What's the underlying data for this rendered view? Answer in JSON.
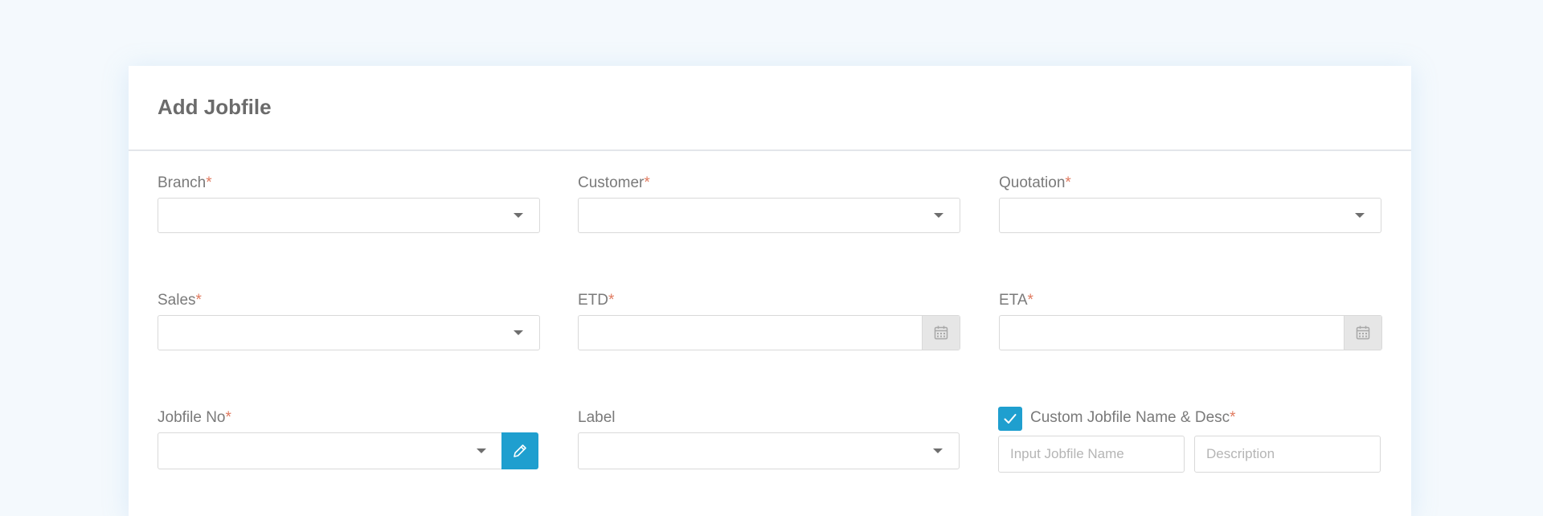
{
  "form": {
    "title": "Add Jobfile",
    "required_mark": "*",
    "fields": {
      "branch": {
        "label": "Branch",
        "value": ""
      },
      "customer": {
        "label": "Customer",
        "value": ""
      },
      "quotation": {
        "label": "Quotation",
        "value": ""
      },
      "sales": {
        "label": "Sales",
        "value": ""
      },
      "etd": {
        "label": "ETD",
        "value": ""
      },
      "eta": {
        "label": "ETA",
        "value": ""
      },
      "jobfile_no": {
        "label": "Jobfile No",
        "value": ""
      },
      "label": {
        "label": "Label",
        "value": ""
      },
      "custom": {
        "label": "Custom Jobfile Name & Desc",
        "checked": true,
        "name_placeholder": "Input Jobfile Name",
        "desc_placeholder": "Description"
      }
    }
  },
  "icons": {
    "dropdown": "caret-down-icon",
    "calendar": "calendar-icon",
    "edit": "pencil-icon",
    "check": "checkmark-icon"
  },
  "colors": {
    "accent": "#1f9fcf",
    "required": "#e07a5f",
    "label": "#7a7a7a",
    "title": "#6b6b6b",
    "page_bg": "#f4f9fd"
  }
}
